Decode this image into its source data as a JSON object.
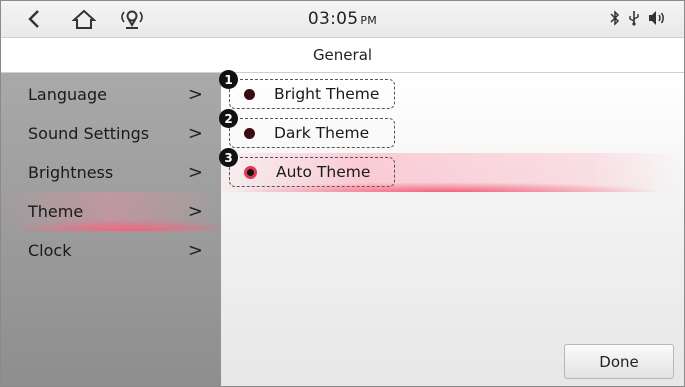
{
  "statusbar": {
    "time": "03:05",
    "ampm": "PM",
    "icons": [
      "back-icon",
      "home-icon",
      "location-icon",
      "bluetooth-icon",
      "usb-icon",
      "volume-icon"
    ]
  },
  "header": {
    "title": "General"
  },
  "sidebar": {
    "items": [
      {
        "label": "Language"
      },
      {
        "label": "Sound Settings"
      },
      {
        "label": "Brightness"
      },
      {
        "label": "Theme",
        "active": true
      },
      {
        "label": "Clock"
      }
    ]
  },
  "themes": {
    "options": [
      {
        "label": "Bright Theme",
        "callout": "1"
      },
      {
        "label": "Dark Theme",
        "callout": "2"
      },
      {
        "label": "Auto Theme",
        "callout": "3",
        "selected": true
      }
    ]
  },
  "done_label": "Done",
  "colors": {
    "accent": "#e03a55",
    "sidebar": "#9c9c9c"
  }
}
